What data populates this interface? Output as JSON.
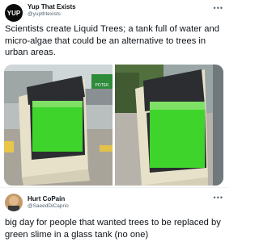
{
  "post1": {
    "author_name": "Yup That Exists",
    "author_handle": "@yupthtexists",
    "avatar_text": "YUP",
    "text": "Scientists create Liquid Trees; a tank full of water and micro-algae that could be an alternative to trees in urban areas."
  },
  "post2": {
    "author_name": "Hurt CoPain",
    "author_handle": "@SaeedDiCaprio",
    "text": "big day for people that wanted trees to be replaced by green slime in a glass tank (no one)"
  },
  "more_label": "•••",
  "photo_sign": "POTEK",
  "colors": {
    "algae": "#3fd42b",
    "panel_dark": "#2b2d30",
    "frame": "#e6e1c8"
  }
}
